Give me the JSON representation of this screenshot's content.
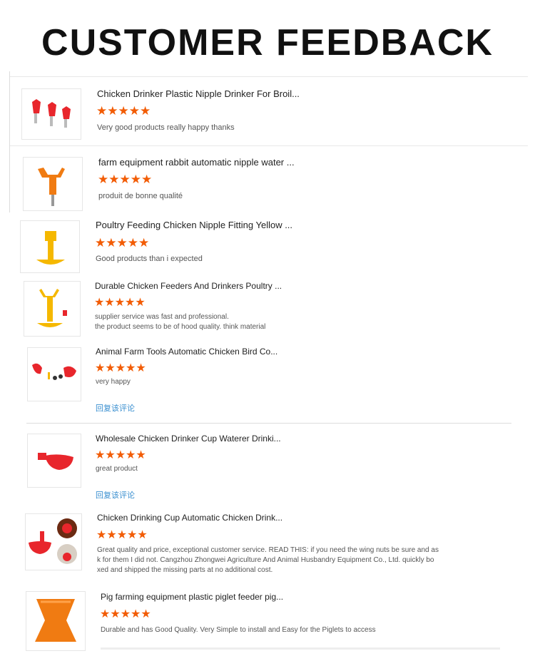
{
  "header": {
    "title": "CUSTOMER FEEDBACK"
  },
  "reviews": [
    {
      "product": "Chicken Drinker Plastic Nipple Drinker For Broil...",
      "rating": 5,
      "stars": "★★★★★",
      "comment": "Very good products really happy thanks"
    },
    {
      "product": "farm equipment rabbit automatic nipple water ...",
      "rating": 5,
      "stars": "★★★★★",
      "comment": "produit de bonne qualité"
    },
    {
      "product": "Poultry Feeding Chicken Nipple Fitting Yellow ...",
      "rating": 5,
      "stars": "★★★★★",
      "comment": "Good products than i expected"
    },
    {
      "product": "Durable Chicken Feeders And Drinkers Poultry ...",
      "rating": 5,
      "stars": "★★★★★",
      "comment": "supplier service was fast and professional.",
      "comment2": "the product seems to be of hood quality. think material"
    },
    {
      "product": "Animal Farm Tools Automatic Chicken Bird Co...",
      "rating": 5,
      "stars": "★★★★★",
      "comment": "very happy",
      "reply": "回复该评论"
    },
    {
      "product": "Wholesale Chicken Drinker Cup Waterer Drinki...",
      "rating": 5,
      "stars": "★★★★★",
      "comment": "great product",
      "reply": "回复该评论"
    },
    {
      "product": "Chicken Drinking Cup Automatic Chicken Drink...",
      "rating": 5,
      "stars": "★★★★★",
      "comment": "Great quality and price, exceptional customer service. READ THIS: if you need the wing nuts be sure and as",
      "comment2": "k for them I did not. Cangzhou Zhongwei Agriculture And Animal Husbandry Equipment Co., Ltd. quickly bo",
      "comment3": "xed and shipped the missing parts at no additional cost."
    },
    {
      "product": "Pig farming equipment plastic piglet feeder pig...",
      "rating": 5,
      "stars": "★★★★★",
      "comment": "Durable and has Good Quality. Very Simple to install and Easy for the Piglets to access"
    }
  ],
  "colors": {
    "star": "#f25c05",
    "reply_link": "#3a8fd0",
    "product_red": "#e8262c",
    "product_yellow": "#f5b800",
    "product_orange": "#f07b12"
  },
  "icons": [
    "nipple-drinker-icon",
    "rabbit-nipple-icon",
    "yellow-nipple-cup-icon",
    "feeder-drinker-icon",
    "bird-cup-icon",
    "red-cup-icon",
    "drinking-cup-icon",
    "piglet-feeder-icon",
    "star-icon"
  ]
}
